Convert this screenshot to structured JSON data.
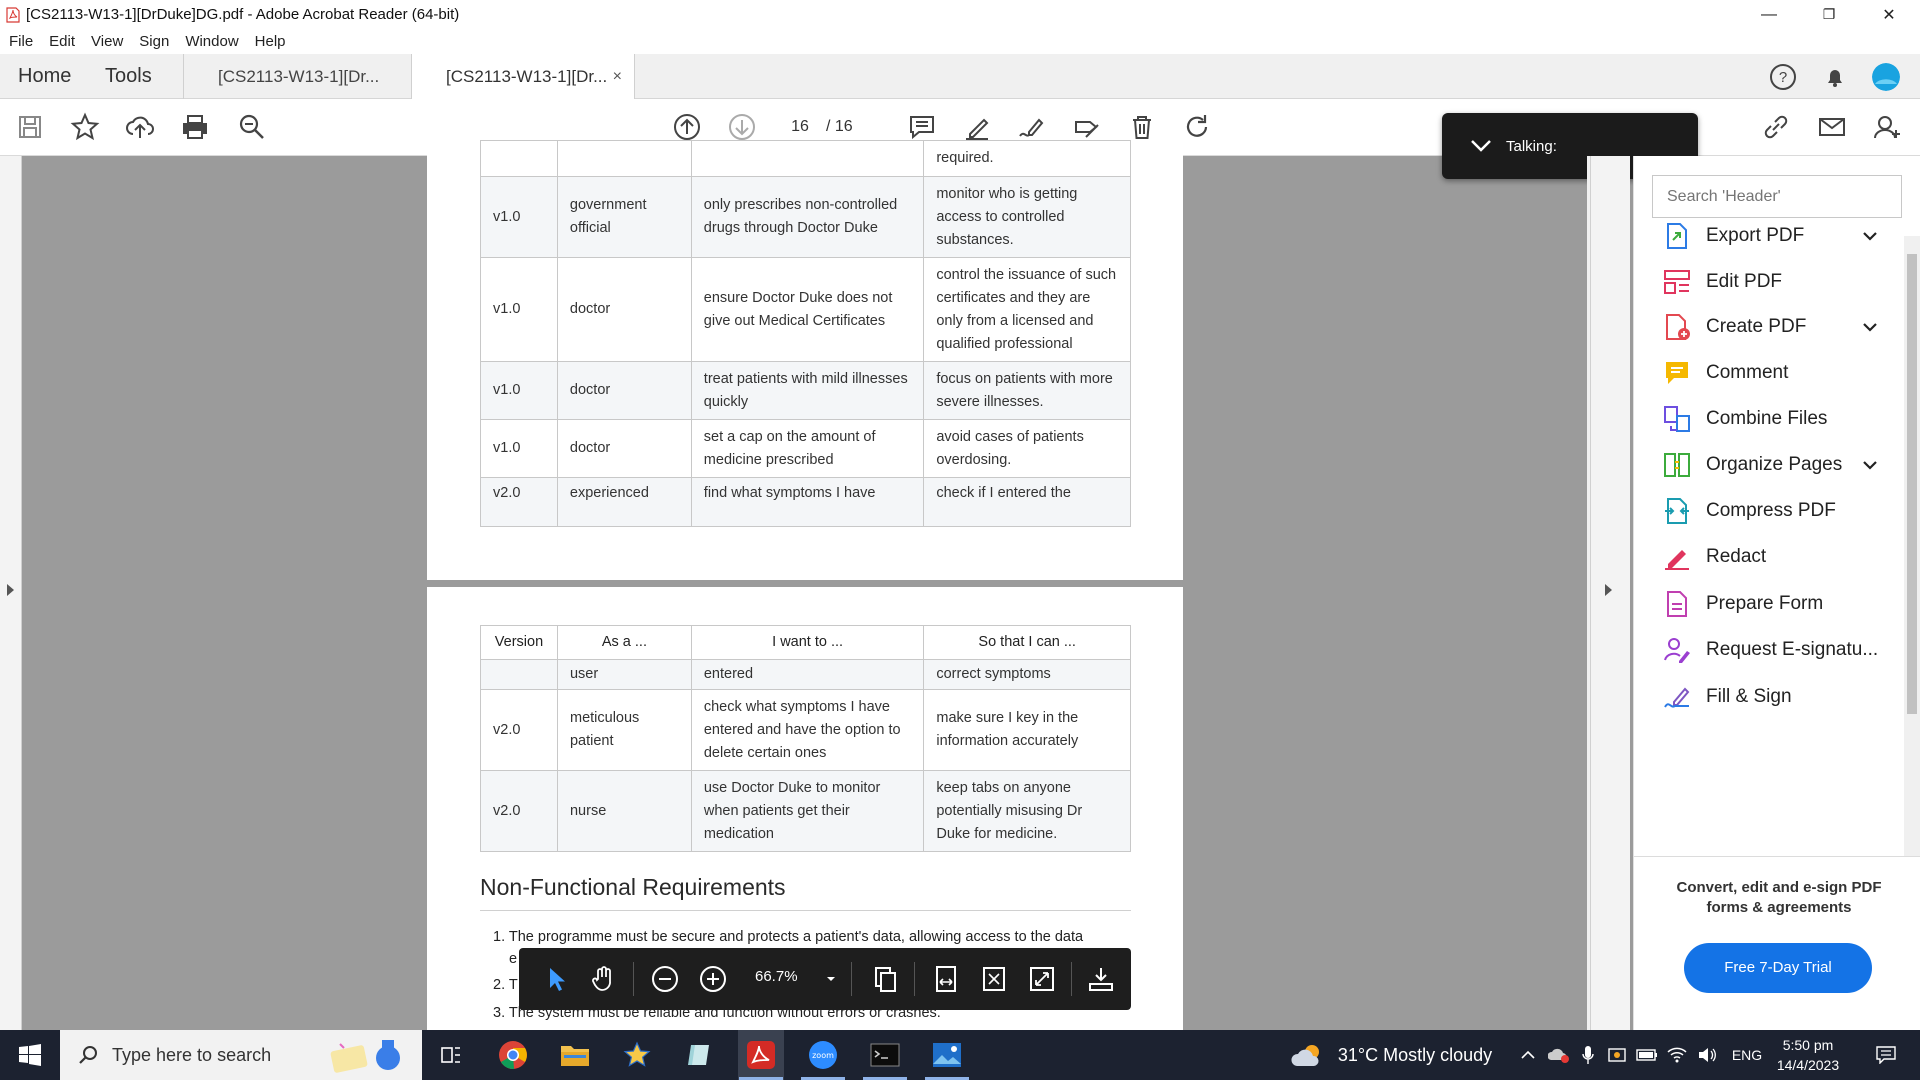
{
  "window": {
    "title": "[CS2113-W13-1][DrDuke]DG.pdf - Adobe Acrobat Reader (64-bit)",
    "minimize": "—",
    "restore": "❐",
    "close": "✕"
  },
  "menu": [
    "File",
    "Edit",
    "View",
    "Sign",
    "Window",
    "Help"
  ],
  "tabs": {
    "home": "Home",
    "tools": "Tools",
    "doc1": "[CS2113-W13-1][Dr...",
    "doc2": "[CS2113-W13-1][Dr...",
    "close_glyph": "×"
  },
  "toolbar": {
    "current_page": "16",
    "total_pages": "/  16"
  },
  "talking": {
    "label": "Talking:"
  },
  "page1_rows": [
    {
      "version": "",
      "role": "",
      "want": "",
      "so_that": "required."
    },
    {
      "version": "v1.0",
      "role": "government official",
      "want": "only prescribes non-controlled drugs through Doctor Duke",
      "so_that": "monitor who is getting access to controlled substances."
    },
    {
      "version": "v1.0",
      "role": "doctor",
      "want": "ensure Doctor Duke does not give out Medical Certificates",
      "so_that": "control the issuance of such certificates and they are only from a licensed and qualified professional"
    },
    {
      "version": "v1.0",
      "role": "doctor",
      "want": "treat patients with mild illnesses quickly",
      "so_that": "focus on patients with more severe illnesses."
    },
    {
      "version": "v1.0",
      "role": "doctor",
      "want": "set a cap on the amount of medicine prescribed",
      "so_that": "avoid cases of patients overdosing."
    },
    {
      "version": "v2.0",
      "role": "experienced",
      "want": "find what symptoms I have",
      "so_that": "check if I entered the"
    }
  ],
  "page2_headers": [
    "Version",
    "As a ...",
    "I want to ...",
    "So that I can ..."
  ],
  "page2_rows": [
    {
      "version": "",
      "role": "user",
      "want": "entered",
      "so_that": "correct symptoms"
    },
    {
      "version": "v2.0",
      "role": "meticulous patient",
      "want": "check what symptoms I have entered and have the option to delete certain ones",
      "so_that": "make sure I key in the information accurately"
    },
    {
      "version": "v2.0",
      "role": "nurse",
      "want": "use Doctor Duke to monitor when patients get their medication",
      "so_that": "keep tabs on anyone potentially misusing Dr Duke for medicine."
    }
  ],
  "nonfunctional": {
    "heading": "Non-Functional Requirements",
    "item1": "1. The programme must be secure and protects a patient's data, allowing access to the data",
    "item1b": "e",
    "item2": "2. T",
    "item3": "3. The system must be reliable and function without errors or crashes."
  },
  "floatbar": {
    "zoom": "66.7%"
  },
  "rightpanel": {
    "search_placeholder": "Search 'Header'",
    "tools": [
      {
        "label": "Export PDF",
        "icon": "export-pdf-icon",
        "color": "#2c7be5",
        "has_chevron": true
      },
      {
        "label": "Edit PDF",
        "icon": "edit-pdf-icon",
        "color": "#e0355e",
        "has_chevron": false
      },
      {
        "label": "Create PDF",
        "icon": "create-pdf-icon",
        "color": "#e34850",
        "has_chevron": true
      },
      {
        "label": "Comment",
        "icon": "comment-icon",
        "color": "#f5b800",
        "has_chevron": false
      },
      {
        "label": "Combine Files",
        "icon": "combine-files-icon",
        "color": "#6d4fe0",
        "has_chevron": false
      },
      {
        "label": "Organize Pages",
        "icon": "organize-pages-icon",
        "color": "#3cab3c",
        "has_chevron": true
      },
      {
        "label": "Compress PDF",
        "icon": "compress-pdf-icon",
        "color": "#1a9cb0",
        "has_chevron": false
      },
      {
        "label": "Redact",
        "icon": "redact-icon",
        "color": "#e0355e",
        "has_chevron": false
      },
      {
        "label": "Prepare Form",
        "icon": "prepare-form-icon",
        "color": "#c03fb0",
        "has_chevron": false
      },
      {
        "label": "Request E-signatu...",
        "icon": "request-esign-icon",
        "color": "#9b3fd0",
        "has_chevron": false
      },
      {
        "label": "Fill & Sign",
        "icon": "fill-sign-icon",
        "color": "#7e57c2",
        "has_chevron": false
      }
    ],
    "promo": "Convert, edit and e-sign PDF forms & agreements",
    "trial_button": "Free 7-Day Trial"
  },
  "taskbar": {
    "search_placeholder": "Type here to search",
    "weather": "31°C  Mostly cloudy",
    "lang": "ENG",
    "time": "5:50 pm",
    "date": "14/4/2023"
  }
}
